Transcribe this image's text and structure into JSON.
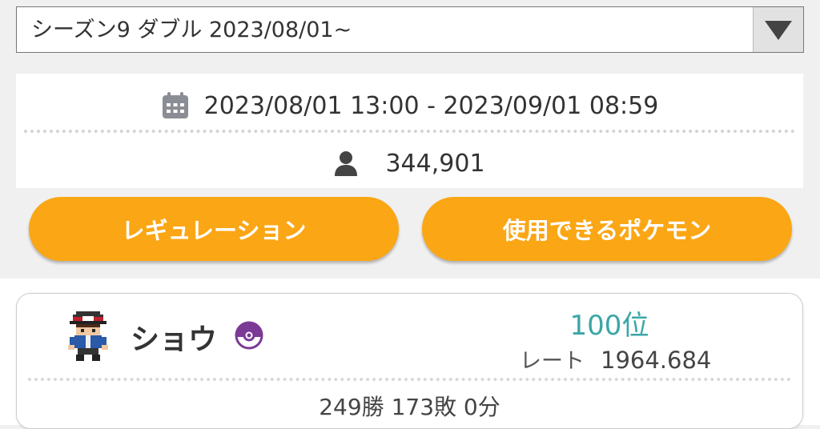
{
  "season_select": {
    "selected": "シーズン9 ダブル 2023/08/01~",
    "arrow_icon": "dropdown-triangle-icon"
  },
  "season_info": {
    "period": "2023/08/01 13:00 - 2023/09/01 08:59",
    "period_icon": "calendar-icon",
    "player_count": "344,901",
    "player_icon": "person-icon"
  },
  "buttons": {
    "regulation": "レギュレーション",
    "usable_pokemon": "使用できるポケモン"
  },
  "ranking_entry": {
    "name": "ショウ",
    "badge_icon": "monster-ball-icon",
    "rank": "100位",
    "rate_label": "レート",
    "rate_value": "1964.684",
    "record": "249勝 173敗 0分"
  },
  "colors": {
    "accent_orange": "#fba614",
    "rank_teal": "#3aa6a6",
    "badge_purple": "#7b3a96"
  }
}
